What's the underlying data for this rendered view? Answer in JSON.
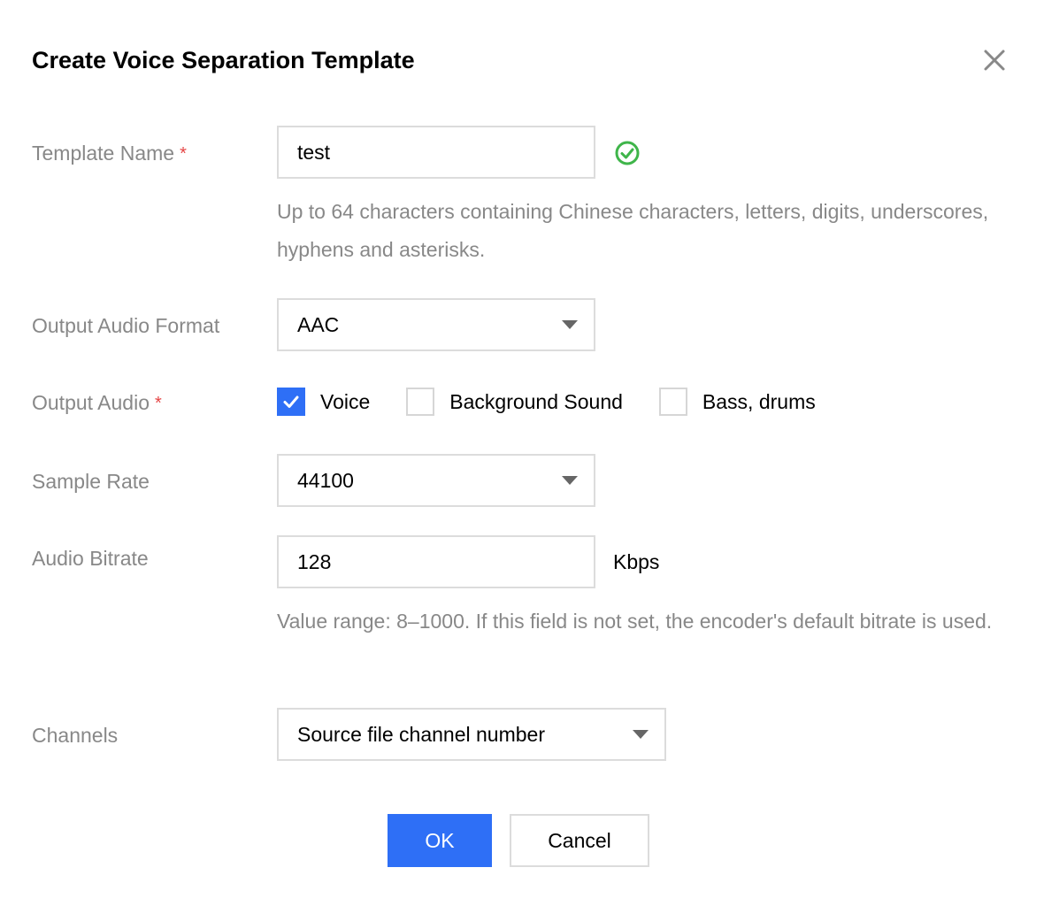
{
  "dialog": {
    "title": "Create Voice Separation Template"
  },
  "form": {
    "template_name": {
      "label": "Template Name",
      "required_mark": "*",
      "value": "test",
      "hint": "Up to 64 characters containing Chinese characters, letters, digits, underscores, hyphens and asterisks."
    },
    "output_audio_format": {
      "label": "Output Audio Format",
      "selected": "AAC"
    },
    "output_audio": {
      "label": "Output Audio",
      "required_mark": "*",
      "options": [
        {
          "label": "Voice",
          "checked": true
        },
        {
          "label": "Background Sound",
          "checked": false
        },
        {
          "label": "Bass, drums",
          "checked": false
        }
      ]
    },
    "sample_rate": {
      "label": "Sample Rate",
      "selected": "44100"
    },
    "audio_bitrate": {
      "label": "Audio Bitrate",
      "value": "128",
      "unit": "Kbps",
      "hint": "Value range: 8–1000. If this field is not set, the encoder's default bitrate is used."
    },
    "channels": {
      "label": "Channels",
      "selected": "Source file channel number"
    }
  },
  "footer": {
    "ok_label": "OK",
    "cancel_label": "Cancel"
  },
  "colors": {
    "primary": "#2e6ff6",
    "required": "#e54545",
    "valid": "#3fb54a",
    "label": "#888888",
    "border": "#dcdcdc"
  },
  "icons": {
    "close": "close-icon",
    "valid": "check-circle-icon",
    "checkmark": "checkmark-icon",
    "dropdown": "caret-down-icon"
  }
}
